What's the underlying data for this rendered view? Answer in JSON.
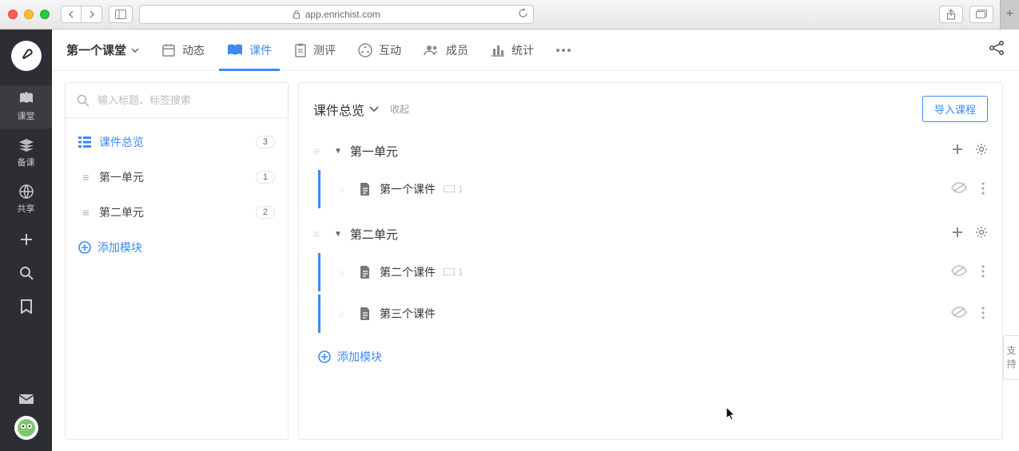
{
  "browser": {
    "url": "app.enrichist.com",
    "lock_icon": "lock-icon"
  },
  "sidebar": {
    "items": [
      {
        "label": "课堂",
        "icon": "book-icon"
      },
      {
        "label": "备课",
        "icon": "layers-icon"
      },
      {
        "label": "共享",
        "icon": "globe-icon"
      }
    ]
  },
  "topbar": {
    "class_name": "第一个课堂",
    "tabs": [
      {
        "label": "动态"
      },
      {
        "label": "课件"
      },
      {
        "label": "测评"
      },
      {
        "label": "互动"
      },
      {
        "label": "成员"
      },
      {
        "label": "统计"
      }
    ]
  },
  "search": {
    "placeholder": "输入标题、标签搜索"
  },
  "left_tree": {
    "overview": {
      "label": "课件总览",
      "count": "3"
    },
    "units": [
      {
        "label": "第一单元",
        "count": "1"
      },
      {
        "label": "第二单元",
        "count": "2"
      }
    ],
    "add_label": "添加模块"
  },
  "right": {
    "title": "课件总览",
    "collapse": "收起",
    "import_btn": "导入课程",
    "units": [
      {
        "title": "第一单元",
        "docs": [
          {
            "title": "第一个课件",
            "meta": "1"
          }
        ]
      },
      {
        "title": "第二单元",
        "docs": [
          {
            "title": "第二个课件",
            "meta": "1"
          },
          {
            "title": "第三个课件",
            "meta": ""
          }
        ]
      }
    ],
    "add_label": "添加模块"
  },
  "support": {
    "label": "支持"
  }
}
